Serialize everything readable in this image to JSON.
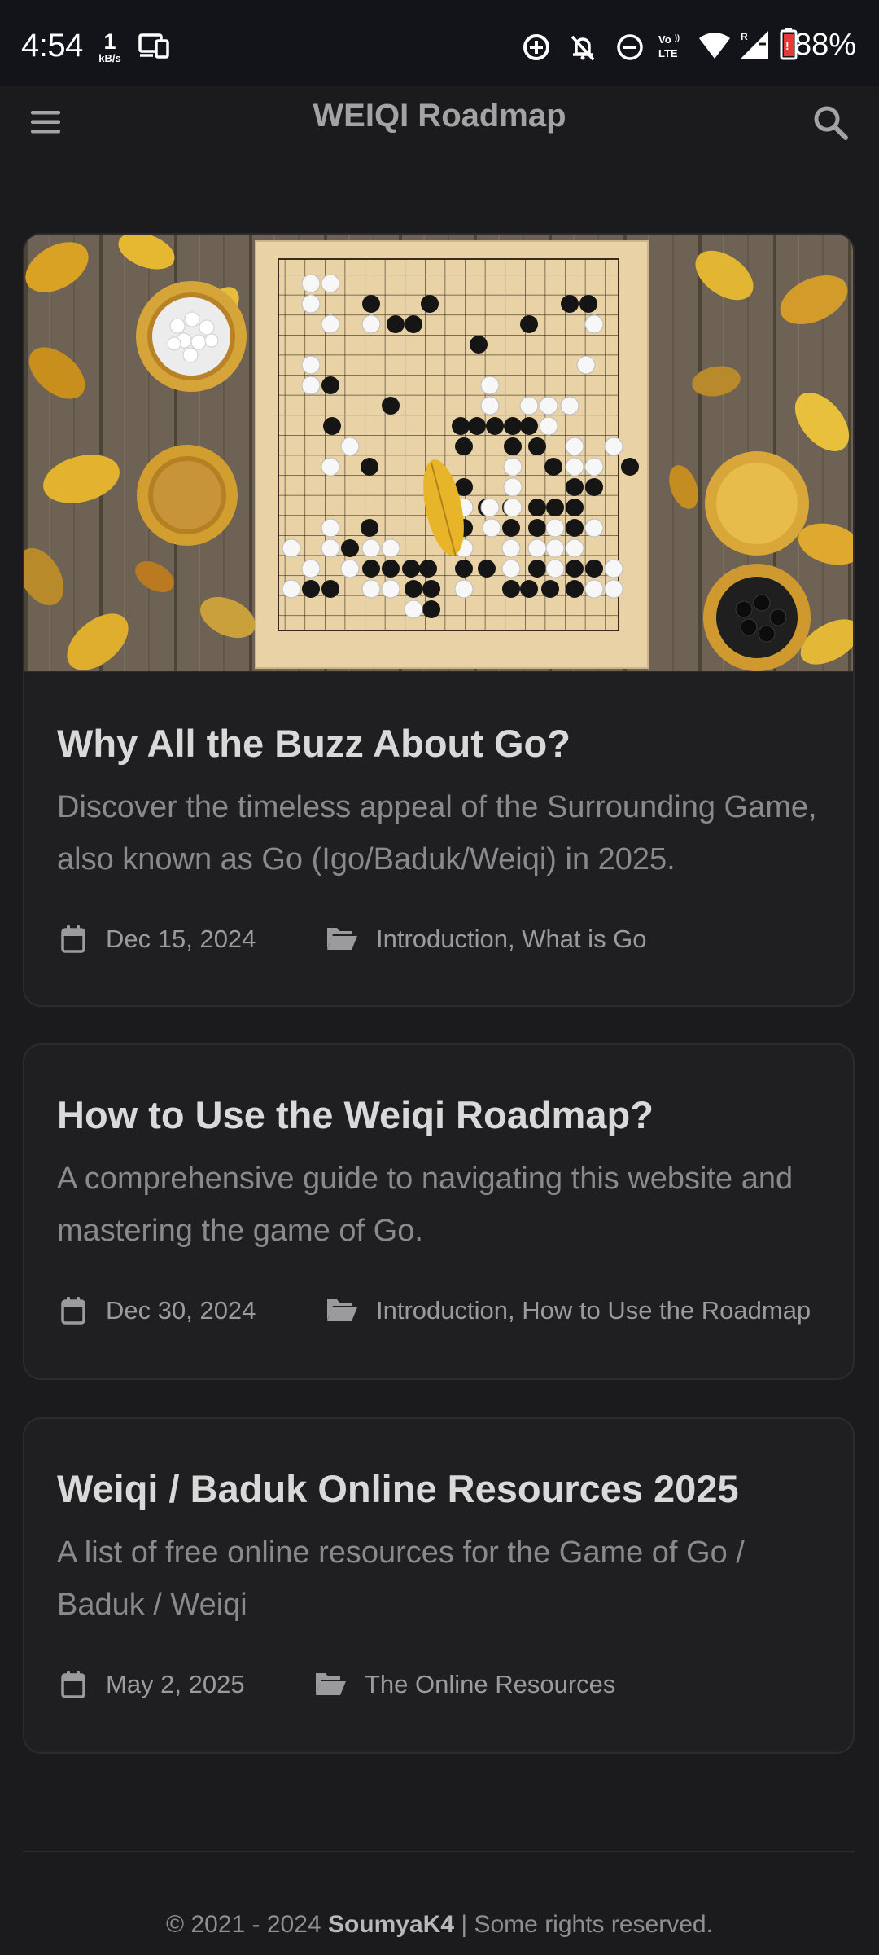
{
  "status_bar": {
    "time": "4:54",
    "speed_value": "1",
    "speed_unit": "kB/s",
    "battery": "88%"
  },
  "header": {
    "title": "WEIQI Roadmap",
    "menu_icon": "hamburger-menu-icon",
    "search_icon": "search-icon"
  },
  "posts": [
    {
      "title": "Why All the Buzz About Go?",
      "description": "Discover the timeless appeal of the Surrounding Game, also known as Go (Igo/Baduk/Weiqi) in 2025.",
      "date": "Dec 15, 2024",
      "categories": [
        "Introduction",
        "What is Go"
      ],
      "categories_text": "Introduction, What is Go",
      "has_image": true
    },
    {
      "title": "How to Use the Weiqi Roadmap?",
      "description": "A comprehensive guide to navigating this website and mastering the game of Go.",
      "date": "Dec 30, 2024",
      "categories": [
        "Introduction",
        "How to Use the Roadmap"
      ],
      "categories_text": "Introduction, How to Use the Roadmap",
      "has_image": false
    },
    {
      "title": "Weiqi / Baduk Online Resources 2025",
      "description": "A list of free online resources for the Game of Go / Baduk / Weiqi",
      "date": "May 2, 2025",
      "categories": [
        "The Online Resources"
      ],
      "categories_text": "The Online Resources",
      "has_image": false
    }
  ],
  "footer": {
    "copyright": "© 2021 - 2024",
    "author": "SoumyaK4",
    "rights": "| Some rights reserved."
  },
  "colors": {
    "background": "#1b1b1e",
    "card": "#1f1f22",
    "status_bar": "#121419",
    "title_text": "#d9d9d9",
    "muted_text": "#8a8a8d",
    "battery_red": "#e53935"
  }
}
